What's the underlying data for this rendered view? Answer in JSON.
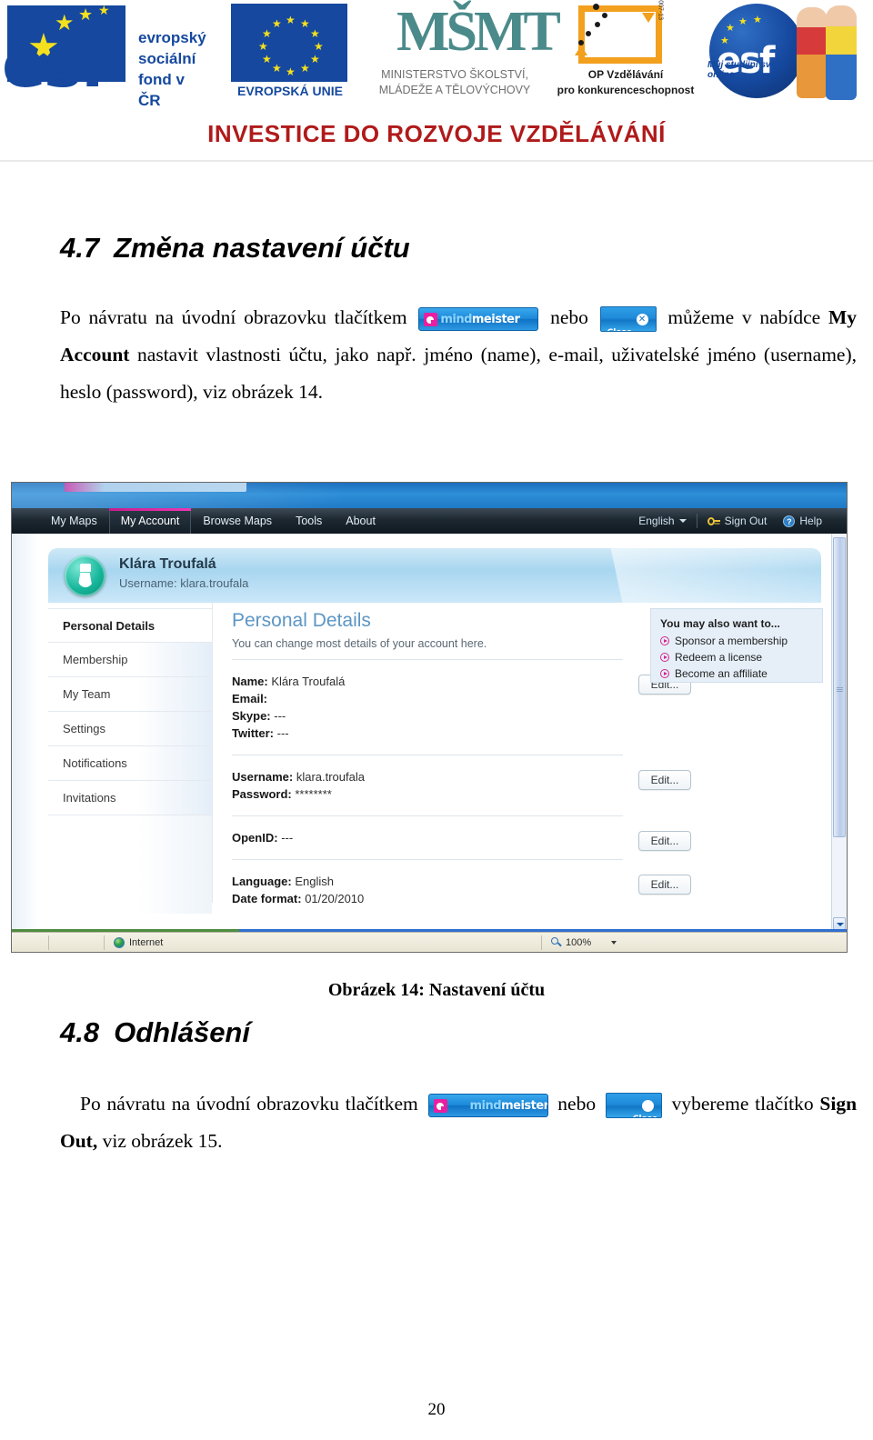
{
  "header": {
    "logos": [
      {
        "name": "esf-cr-logo",
        "word": "esf",
        "lines": [
          "evropský",
          "sociální",
          "fond v ČR"
        ]
      },
      {
        "name": "eu-flag-logo",
        "caption": "EVROPSKÁ UNIE"
      },
      {
        "name": "msmt-logo",
        "mark": "MŠMT",
        "caption_line1": "MINISTERSTVO ŠKOLSTVÍ,",
        "caption_line2": "MLÁDEŽE A TĚLOVÝCHOVY"
      },
      {
        "name": "op-vk-logo",
        "caption_line1": "OP Vzdělávání",
        "caption_line2": "pro konkurenceschopnost",
        "side_text": "2007-13"
      },
      {
        "name": "esf-globe-logo",
        "word": "esf",
        "arc_text": "Můj studijní svět online"
      }
    ],
    "banner": "INVESTICE DO ROZVOJE  VZDĚLÁVÁNÍ"
  },
  "doc": {
    "section_47": {
      "number": "4.7",
      "title": "Změna nastavení účtu",
      "para_part1": "Po návratu na úvodní obrazovku tlačítkem",
      "para_part2": "nebo",
      "para_part3": "můžeme v nabídce",
      "para_bold1": "My Account",
      "para_part4": "nastavit vlastnosti účtu, jako např. jméno (name), e-mail, uživatelské jméno (username), heslo (password), viz obrázek 14."
    },
    "section_48": {
      "number": "4.8",
      "title": "Odhlášení",
      "para_part1": "Po návratu na úvodní obrazovku tlačítkem",
      "para_part2": "nebo",
      "para_part3": "vybereme tlačítko",
      "para_bold1": "Sign Out,",
      "para_part4": "viz obrázek 15."
    },
    "figure_caption": "Obrázek 14: Nastavení účtu",
    "page_number": "20"
  },
  "inline_buttons": {
    "mindmeister": {
      "text_light": "mind",
      "text_bold": "meister"
    },
    "close": {
      "label": "Close",
      "x_glyph": "✕"
    }
  },
  "screenshot": {
    "nav": {
      "items": [
        {
          "label": "My Maps",
          "active": false
        },
        {
          "label": "My Account",
          "active": true
        },
        {
          "label": "Browse Maps",
          "active": false
        },
        {
          "label": "Tools",
          "active": false
        },
        {
          "label": "About",
          "active": false
        }
      ],
      "language": "English",
      "sign_out": "Sign Out",
      "help": "Help"
    },
    "user": {
      "name": "Klára Troufalá",
      "username_label": "Username: klara.troufala"
    },
    "sidebar": {
      "items": [
        {
          "label": "Personal Details",
          "active": true
        },
        {
          "label": "Membership",
          "active": false
        },
        {
          "label": "My Team",
          "active": false
        },
        {
          "label": "Settings",
          "active": false
        },
        {
          "label": "Notifications",
          "active": false
        },
        {
          "label": "Invitations",
          "active": false
        }
      ]
    },
    "main": {
      "title": "Personal Details",
      "subtitle": "You can change most details of your account here.",
      "edit_label": "Edit...",
      "groups": [
        {
          "lines": [
            {
              "label": "Name:",
              "value": "Klára Troufalá"
            },
            {
              "label": "Email:",
              "value": ""
            },
            {
              "label": "Skype:",
              "value": "---"
            },
            {
              "label": "Twitter:",
              "value": "---"
            }
          ]
        },
        {
          "lines": [
            {
              "label": "Username:",
              "value": "klara.troufala"
            },
            {
              "label": "Password:",
              "value": "********"
            }
          ]
        },
        {
          "lines": [
            {
              "label": "OpenID:",
              "value": "---"
            }
          ]
        },
        {
          "lines": [
            {
              "label": "Language:",
              "value": "English"
            },
            {
              "label": "Date format:",
              "value": "01/20/2010"
            }
          ]
        }
      ]
    },
    "right_panel": {
      "title": "You may also want to...",
      "items": [
        "Sponsor a membership",
        "Redeem a license",
        "Become an affiliate"
      ]
    },
    "statusbar": {
      "zone": "Internet",
      "zoom": "100%"
    }
  },
  "colors": {
    "accent_pink": "#d4268e",
    "brand_blue": "#15489e",
    "banner_red": "#b01a1a",
    "pane_title_blue": "#5d96c4",
    "avatar_teal": "#17b79c"
  }
}
